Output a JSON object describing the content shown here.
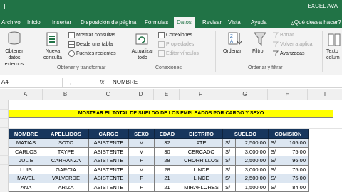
{
  "window": {
    "title": "EXCEL AVA"
  },
  "tabs": [
    {
      "label": "Archivo"
    },
    {
      "label": "Inicio"
    },
    {
      "label": "Insertar"
    },
    {
      "label": "Disposición de página"
    },
    {
      "label": "Fórmulas"
    },
    {
      "label": "Datos",
      "active": true
    },
    {
      "label": "Revisar"
    },
    {
      "label": "Vista"
    },
    {
      "label": "Ayuda"
    }
  ],
  "tell_me": "¿Qué desea hacer?",
  "ribbon": {
    "get_data": "Obtener datos externos",
    "new_query": "Nueva consulta",
    "show_queries": "Mostrar consultas",
    "from_table": "Desde una tabla",
    "recent_sources": "Fuentes recientes",
    "group_get_transform": "Obtener y transformar",
    "refresh_all": "Actualizar todo",
    "connections": "Conexiones",
    "properties": "Propiedades",
    "edit_links": "Editar vínculos",
    "group_connections": "Conexiones",
    "sort": "Ordenar",
    "filter": "Filtro",
    "clear": "Borrar",
    "reapply": "Volver a aplicar",
    "advanced": "Avanzadas",
    "group_sort_filter": "Ordenar y filtrar",
    "text_columns": "Texto colum"
  },
  "formula_bar": {
    "name_box": "A4",
    "fx": "fx",
    "formula": "NOMBRE"
  },
  "columns": [
    "A",
    "B",
    "C",
    "D",
    "E",
    "F",
    "G",
    "H",
    "I"
  ],
  "sheet_title": "MOSTRAR EL TOTAL DE SUELDO DE LOS EMPLEADOS POR CARGO Y SEXO",
  "table": {
    "headers": [
      "NOMBRE",
      "APELLIDOS",
      "CARGO",
      "SEXO",
      "EDAD",
      "DISTRITO",
      "SUELDO",
      "COMISION"
    ],
    "rows": [
      [
        "MATIAS",
        "SOTO",
        "ASISTENTE",
        "M",
        "32",
        "ATE",
        "S/",
        "2,500.00",
        "S/",
        "105.00"
      ],
      [
        "CARLOS",
        "TAYPE",
        "ASISTENTE",
        "M",
        "30",
        "CERCADO",
        "S/",
        "3,000.00",
        "S/",
        "75.00"
      ],
      [
        "JULIE",
        "CARRANZA",
        "ASISTENTE",
        "F",
        "28",
        "CHORRILLOS",
        "S/",
        "2,500.00",
        "S/",
        "96.00"
      ],
      [
        "LUIS",
        "GARCIA",
        "ASISTENTE",
        "M",
        "28",
        "LINCE",
        "S/",
        "3,000.00",
        "S/",
        "75.00"
      ],
      [
        "MAVEL",
        "VALVERDE",
        "ASISTENTE",
        "F",
        "21",
        "LINCE",
        "S/",
        "2,500.00",
        "S/",
        "75.00"
      ],
      [
        "ANA",
        "ARIZA",
        "ASISTENTE",
        "F",
        "21",
        "MIRAFLORES",
        "S/",
        "1,500.00",
        "S/",
        "84.00"
      ]
    ]
  }
}
